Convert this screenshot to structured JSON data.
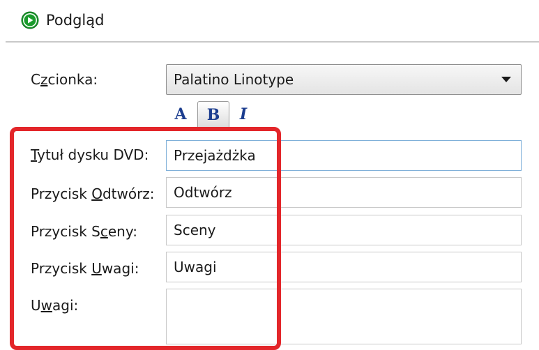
{
  "header": {
    "preview_label": "Podgląd",
    "preview_icon": "play-icon",
    "accent_color": "#1a9b2c"
  },
  "font": {
    "label_pre": "C",
    "label_u": "z",
    "label_post": "cionka:",
    "value": "Palatino Linotype",
    "style_buttons": {
      "font_glyph": "A",
      "bold_glyph": "B",
      "italic_glyph": "I"
    }
  },
  "fields": {
    "dvd_title": {
      "label_pre": "",
      "label_u": "T",
      "label_post": "ytuł dysku DVD:",
      "value": "Przejażdżka"
    },
    "play_button": {
      "label_pre": "Przycisk ",
      "label_u": "O",
      "label_post": "dtwórz:",
      "value": "Odtwórz"
    },
    "scenes_button": {
      "label_pre": "Przycisk S",
      "label_u": "c",
      "label_post": "eny:",
      "value": "Sceny"
    },
    "notes_button": {
      "label_pre": "Przycisk ",
      "label_u": "U",
      "label_post": "wagi:",
      "value": "Uwagi"
    },
    "notes": {
      "label_pre": "U",
      "label_u": "w",
      "label_post": "agi:",
      "value": ""
    }
  },
  "highlight_color": "#e3262a"
}
